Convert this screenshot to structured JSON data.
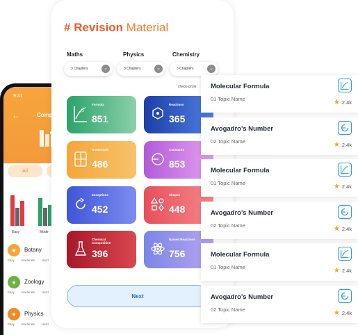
{
  "back_phone": {
    "time": "9:41",
    "title": "Comp",
    "tabs": [
      "All",
      ""
    ],
    "chart_labels": [
      "Easy",
      "Mode"
    ],
    "subjects": [
      {
        "name": "Botany",
        "sub": [
          "Easy",
          "Moderate",
          "Hard"
        ],
        "color": "#f6a53e"
      },
      {
        "name": "Zoology",
        "sub": [
          "Easy",
          "Moderate",
          "Hard"
        ],
        "color": "#6cb33f"
      },
      {
        "name": "Physics",
        "sub": [
          "Easy",
          "Moderate",
          "Hard"
        ],
        "color": "#f08a24"
      }
    ]
  },
  "main": {
    "title": {
      "hash": "#",
      "bold": "Revision",
      "rest": "Material"
    },
    "subjects": [
      {
        "label": "Maths",
        "dropdown": "3 Chapters"
      },
      {
        "label": "Physics",
        "dropdown": "3 Chapters"
      },
      {
        "label": "Chemistry",
        "dropdown": "3 Chapters"
      }
    ],
    "check_label": "check-circle",
    "cards": [
      {
        "title": "Formula",
        "value": "851",
        "icon": "fx-graph-icon",
        "from": "#2aa36b",
        "to": "#8cd0a8"
      },
      {
        "title": "Reactions",
        "value": "365",
        "icon": "molecule-icon",
        "from": "#1c3fa8",
        "to": "#4f7ee0"
      },
      {
        "title": "Numericals",
        "value": "486",
        "icon": "calculator-icon",
        "from": "#f5a63a",
        "to": "#f7c36a"
      },
      {
        "title": "Constants",
        "value": "853",
        "icon": "constant-icon",
        "from": "#b25ad8",
        "to": "#e3a0f0"
      },
      {
        "title": "Exceptions",
        "value": "452",
        "icon": "refresh-icon",
        "from": "#3f55d8",
        "to": "#7c8cf0"
      },
      {
        "title": "Shapes",
        "value": "448",
        "icon": "shapes-icon",
        "from": "#e84f5a",
        "to": "#f4868a"
      },
      {
        "title": "Chemical Composition",
        "value": "396",
        "icon": "flask-icon",
        "from": "#a8182a",
        "to": "#d9474f"
      },
      {
        "title": "Named Reactions",
        "value": "756",
        "icon": "atom-icon",
        "from": "#7a86e8",
        "to": "#b8a4ef"
      }
    ],
    "next_label": "Next"
  },
  "topics": [
    {
      "name": "Molecular Formula",
      "sub": "01 Topic Name",
      "rating": "2.4k",
      "icon": "graph-icon"
    },
    {
      "name": "Avogadro's Number",
      "sub": "02 Topic Name",
      "rating": "2.4k",
      "icon": "cycle-icon"
    },
    {
      "name": "Molecular Formula",
      "sub": "01 Topic Name",
      "rating": "2.4k",
      "icon": "graph-icon"
    },
    {
      "name": "Avogadro's Number",
      "sub": "02 Topic Name",
      "rating": "2.4k",
      "icon": "cycle-icon"
    },
    {
      "name": "Molecular Formula",
      "sub": "01 Topic Name",
      "rating": "2.4k",
      "icon": "graph-icon"
    },
    {
      "name": "Avogadro's Number",
      "sub": "02 Topic Name",
      "rating": "2.4k",
      "icon": "cycle-icon"
    }
  ]
}
